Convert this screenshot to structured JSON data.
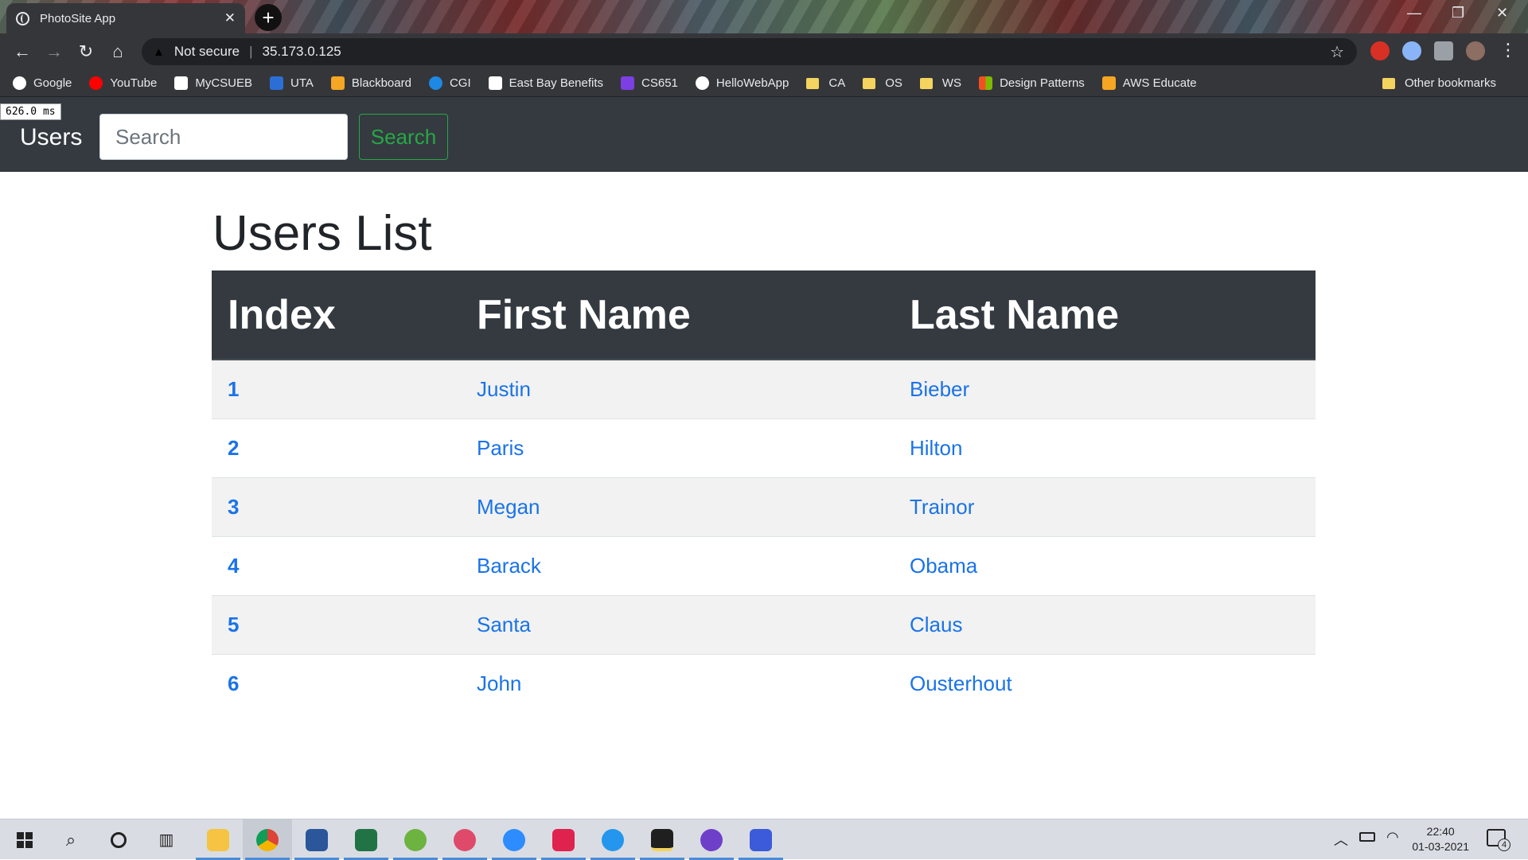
{
  "browser": {
    "tab_title": "PhotoSite App",
    "tab_close": "✕",
    "new_tab": "+",
    "minimize": "—",
    "maximize": "❐",
    "close": "✕",
    "not_secure": "Not secure",
    "separator": "|",
    "url": "35.173.0.125",
    "bookmarks": [
      {
        "label": "Google",
        "icon_color": "#ffffff"
      },
      {
        "label": "YouTube",
        "icon_color": "#ff0000"
      },
      {
        "label": "MyCSUEB",
        "icon_color": "#ffffff"
      },
      {
        "label": "UTA",
        "icon_color": "#2b6fd6"
      },
      {
        "label": "Blackboard",
        "icon_color": "#f5a623"
      },
      {
        "label": "CGI",
        "icon_color": "#1e88e5"
      },
      {
        "label": "East Bay Benefits",
        "icon_color": "#ffffff"
      },
      {
        "label": "CS651",
        "icon_color": "#7b3fe4"
      },
      {
        "label": "HelloWebApp",
        "icon_color": "#ffffff"
      },
      {
        "label": "CA",
        "icon_color": "#f4d35e"
      },
      {
        "label": "OS",
        "icon_color": "#f4d35e"
      },
      {
        "label": "WS",
        "icon_color": "#f4d35e"
      },
      {
        "label": "Design Patterns",
        "icon_color": "#4caf50"
      },
      {
        "label": "AWS Educate",
        "icon_color": "#f5a623"
      }
    ],
    "other_bookmarks": "Other bookmarks",
    "timing_overlay": "626.0 ms"
  },
  "navbar": {
    "brand": "Users",
    "search_placeholder": "Search",
    "search_button": "Search"
  },
  "main": {
    "title": "Users List",
    "columns": [
      "Index",
      "First Name",
      "Last Name"
    ],
    "rows": [
      {
        "index": "1",
        "first": "Justin",
        "last": "Bieber"
      },
      {
        "index": "2",
        "first": "Paris",
        "last": "Hilton"
      },
      {
        "index": "3",
        "first": "Megan",
        "last": "Trainor"
      },
      {
        "index": "4",
        "first": "Barack",
        "last": "Obama"
      },
      {
        "index": "5",
        "first": "Santa",
        "last": "Claus"
      },
      {
        "index": "6",
        "first": "John",
        "last": "Ousterhout"
      }
    ]
  },
  "taskbar": {
    "time": "22:40",
    "date": "01-03-2021",
    "notifications": "4",
    "apps": [
      {
        "name": "file-explorer",
        "color": "#f6c343"
      },
      {
        "name": "chrome",
        "color": "#db4437"
      },
      {
        "name": "word",
        "color": "#2b579a"
      },
      {
        "name": "excel",
        "color": "#217346"
      },
      {
        "name": "spring-tools",
        "color": "#6db33f"
      },
      {
        "name": "paint-app",
        "color": "#e04a6a"
      },
      {
        "name": "zoom",
        "color": "#2d8cff"
      },
      {
        "name": "rubymine",
        "color": "#e0224f"
      },
      {
        "name": "docker",
        "color": "#2496ed"
      },
      {
        "name": "sticky-notes",
        "color": "#1f1f1f"
      },
      {
        "name": "github-desktop",
        "color": "#6e40c9"
      },
      {
        "name": "network-app",
        "color": "#3b5bdb"
      }
    ]
  },
  "colors": {
    "navbar_bg": "#343a40",
    "link_blue": "#1a73e8",
    "search_green": "#28a745",
    "stripe": "#f2f2f2"
  }
}
